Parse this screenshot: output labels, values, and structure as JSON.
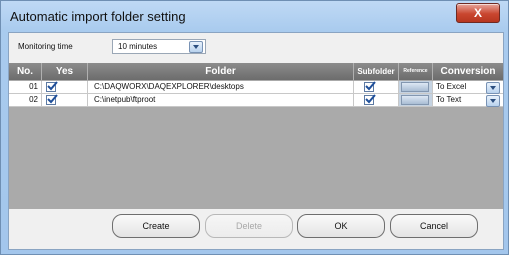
{
  "window": {
    "title": "Automatic import folder setting",
    "close_symbol": "X"
  },
  "monitoring": {
    "label": "Monitoring time",
    "value": "10 minutes"
  },
  "table": {
    "headers": {
      "no": "No.",
      "yes": "Yes",
      "folder": "Folder",
      "subfolder": "Subfolder",
      "reference": "Reference",
      "conversion": "Conversion"
    },
    "rows": [
      {
        "no": "01",
        "yes": true,
        "folder": "C:\\DAQWORX\\DAQEXPLORER\\desktops",
        "subfolder": true,
        "conversion": "To Excel"
      },
      {
        "no": "02",
        "yes": true,
        "folder": "C:\\inetpub\\ftproot",
        "subfolder": true,
        "conversion": "To Text"
      }
    ]
  },
  "buttons": {
    "create": "Create",
    "delete": "Delete",
    "ok": "OK",
    "cancel": "Cancel"
  },
  "icons": {
    "close": "close-icon",
    "check": "check-icon",
    "dropdown": "chevron-down-icon"
  }
}
